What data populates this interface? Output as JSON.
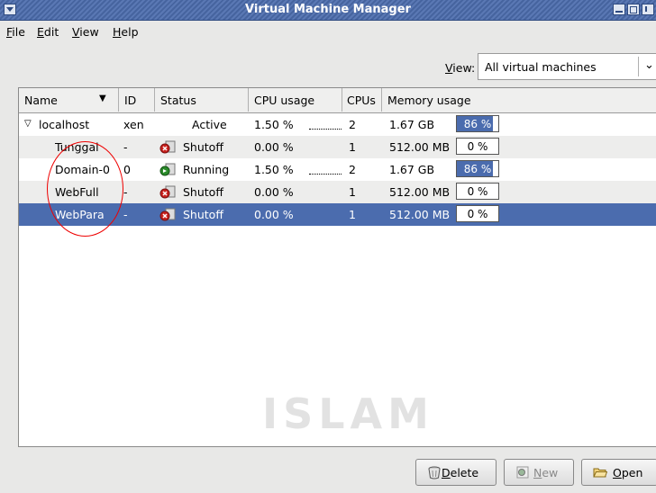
{
  "window": {
    "title": "Virtual Machine Manager"
  },
  "menu": {
    "file": "File",
    "edit": "Edit",
    "view": "View",
    "help": "Help"
  },
  "filter": {
    "label": "View:",
    "value": "All virtual machines"
  },
  "columns": {
    "name": "Name",
    "id": "ID",
    "status": "Status",
    "cpu": "CPU usage",
    "cpus": "CPUs",
    "memory": "Memory usage"
  },
  "rows": [
    {
      "name": "localhost",
      "id": "xen",
      "status": "Active",
      "cpu": "1.50 %",
      "cpus": "2",
      "mem": "1.67 GB",
      "mem_pct": "86 %",
      "mem_fraction": 0.86
    },
    {
      "name": "Tunggal",
      "id": "-",
      "status": "Shutoff",
      "cpu": "0.00 %",
      "cpus": "1",
      "mem": "512.00 MB",
      "mem_pct": "0 %",
      "mem_fraction": 0
    },
    {
      "name": "Domain-0",
      "id": "0",
      "status": "Running",
      "cpu": "1.50 %",
      "cpus": "2",
      "mem": "1.67 GB",
      "mem_pct": "86 %",
      "mem_fraction": 0.86
    },
    {
      "name": "WebFull",
      "id": "-",
      "status": "Shutoff",
      "cpu": "0.00 %",
      "cpus": "1",
      "mem": "512.00 MB",
      "mem_pct": "0 %",
      "mem_fraction": 0
    },
    {
      "name": "WebPara",
      "id": "-",
      "status": "Shutoff",
      "cpu": "0.00 %",
      "cpus": "1",
      "mem": "512.00 MB",
      "mem_pct": "0 %",
      "mem_fraction": 0
    }
  ],
  "buttons": {
    "delete": "Delete",
    "new": "New",
    "open": "Open"
  },
  "watermark": "ISLAM",
  "colors": {
    "selection": "#4b6cae",
    "titlebar": "#5a78b4",
    "annotation": "#e00000"
  }
}
